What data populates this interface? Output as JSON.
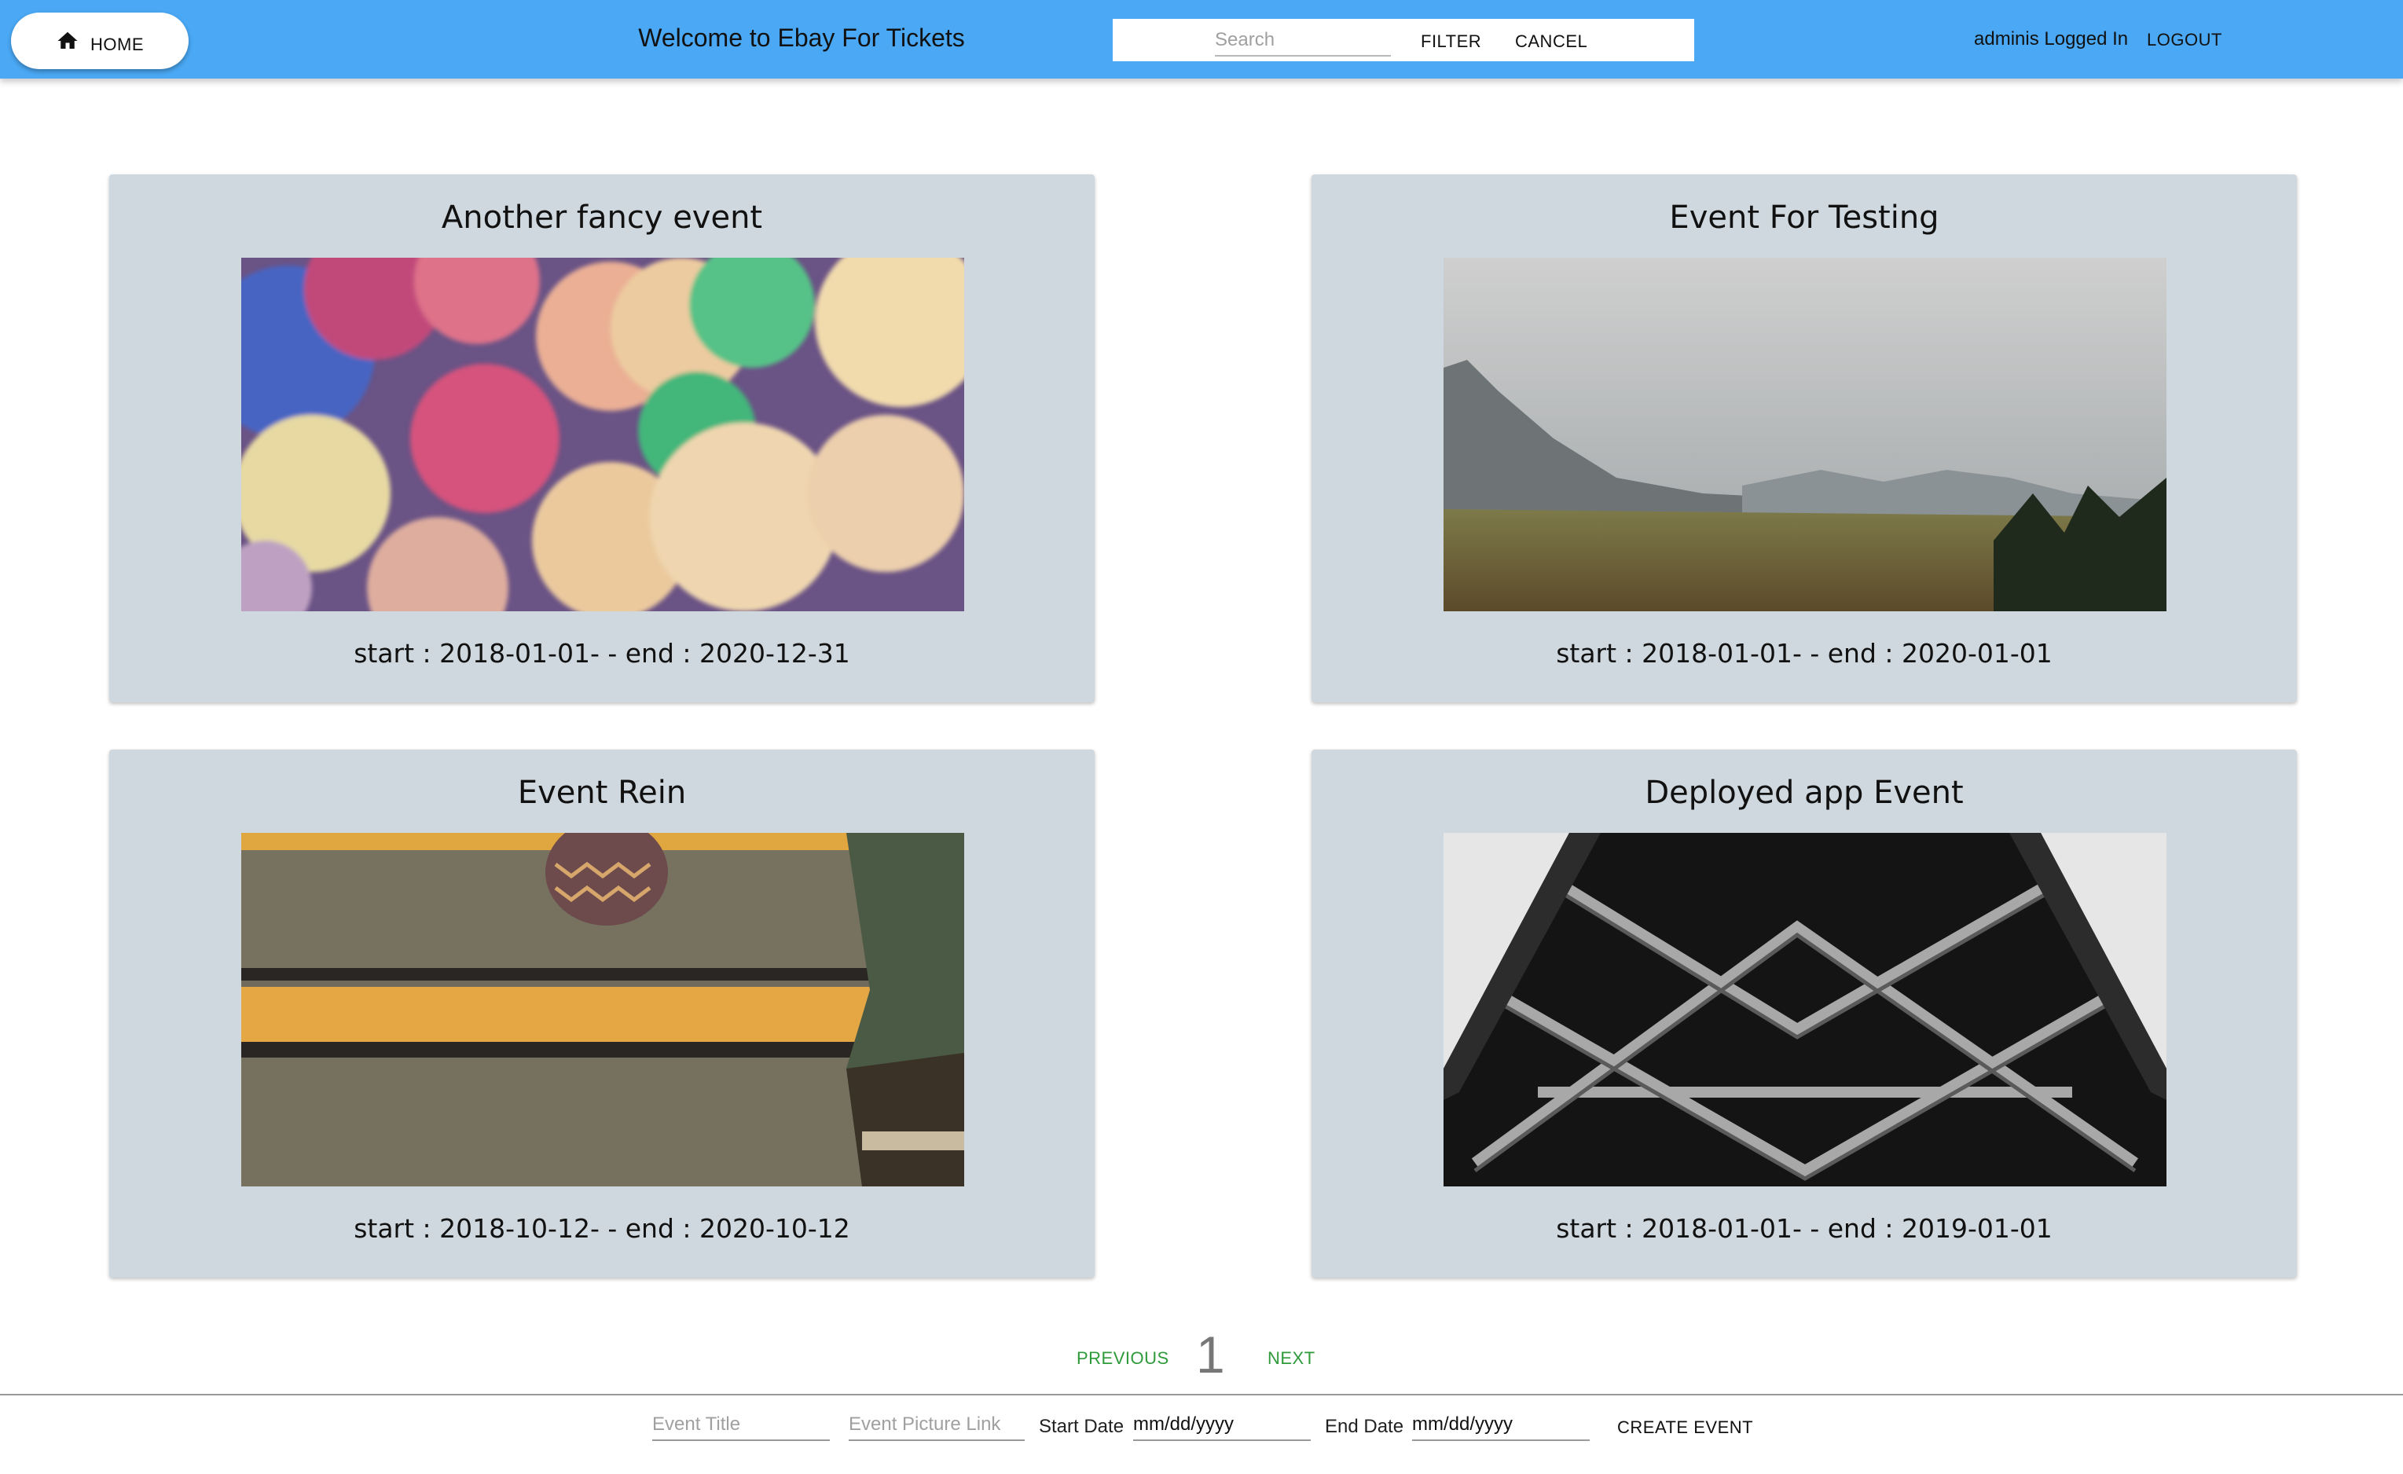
{
  "header": {
    "home_label": "HOME",
    "title": "Welcome to Ebay For Tickets",
    "search_placeholder": "Search",
    "filter_label": "FILTER",
    "cancel_label": "CANCEL",
    "user_status": "adminis Logged In",
    "logout_label": "LOGOUT",
    "bar_color": "#4aa8f4"
  },
  "events": [
    {
      "title": "Another fancy event",
      "dates": "start : 2018-01-01- - end : 2020-12-31",
      "image": "bokeh-lights"
    },
    {
      "title": "Event For Testing",
      "dates": "start : 2018-01-01- - end : 2020-01-01",
      "image": "mountain-valley"
    },
    {
      "title": "Event Rein",
      "dates": "start : 2018-10-12- - end : 2020-10-12",
      "image": "stairs-shoe"
    },
    {
      "title": "Deployed app Event",
      "dates": "start : 2018-01-01- - end : 2019-01-01",
      "image": "steel-tower"
    }
  ],
  "pagination": {
    "previous_label": "PREVIOUS",
    "page": "1",
    "next_label": "NEXT",
    "link_color": "#2e9a3a"
  },
  "create_form": {
    "title_placeholder": "Event Title",
    "picture_placeholder": "Event Picture Link",
    "start_label": "Start Date",
    "start_value": "mm/dd/yyyy",
    "end_label": "End Date",
    "end_value": "mm/dd/yyyy",
    "create_label": "CREATE EVENT"
  }
}
